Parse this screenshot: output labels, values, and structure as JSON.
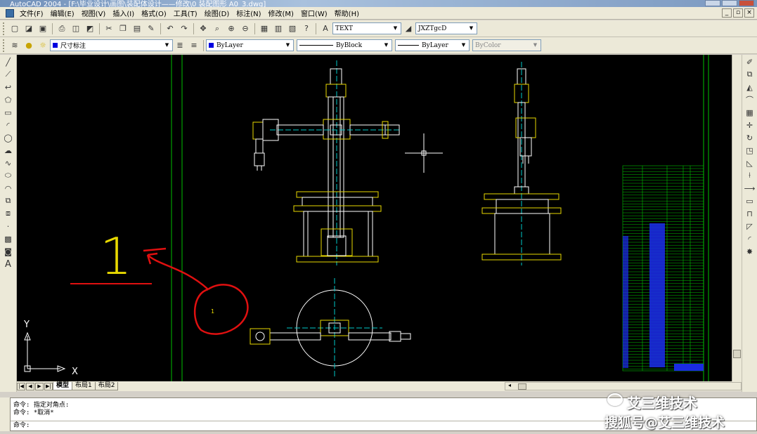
{
  "window": {
    "title": "AutoCAD 2004 - [F:\\毕业设计\\画图\\装配体设计——修改\\0 装配图形 A0_3.dwg]"
  },
  "menu": [
    "文件(F)",
    "编辑(E)",
    "视图(V)",
    "插入(I)",
    "格式(O)",
    "工具(T)",
    "绘图(D)",
    "标注(N)",
    "修改(M)",
    "窗口(W)",
    "帮助(H)"
  ],
  "toolbar": {
    "text_style": "TEXT",
    "dim_style": "JXZTgcD",
    "layer": "尺寸标注",
    "color": "ByLayer",
    "linetype": "ByBlock",
    "lineweight": "ByLayer",
    "plotstyle": "ByColor"
  },
  "colors": {
    "canvas": "#000000",
    "layer_swatch": "#0000e0"
  },
  "canvas": {
    "label_text": "1",
    "small_text": "1",
    "ucs_x": "X",
    "ucs_y": "Y"
  },
  "tabs": [
    "模型",
    "布局1",
    "布局2"
  ],
  "command": {
    "history": [
      "命令: 指定对角点:",
      "命令: *取消*"
    ],
    "prompt": "命令:"
  },
  "watermark": {
    "line1": "艾三维技术",
    "line2": "搜狐号@艾三维技术"
  }
}
